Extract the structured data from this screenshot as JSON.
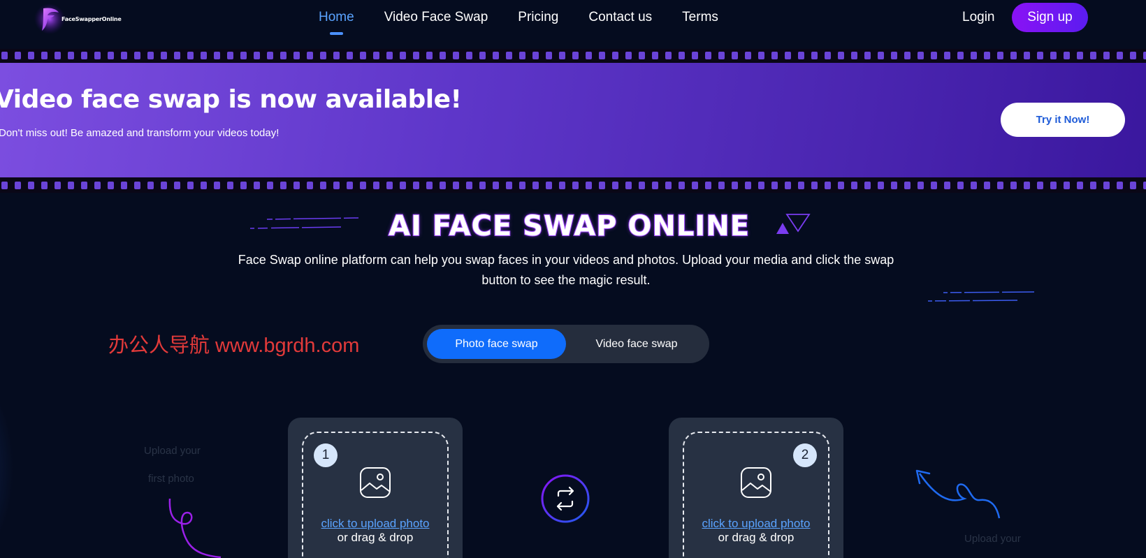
{
  "nav": {
    "logo_text": "FaceSwapperOnline",
    "links": [
      "Home",
      "Video Face Swap",
      "Pricing",
      "Contact us",
      "Terms"
    ],
    "active": "Home",
    "login": "Login",
    "signup": "Sign up"
  },
  "banner": {
    "title": "Video face swap is now available!",
    "subtitle": "Don't miss out! Be amazed and transform your videos today!",
    "cta": "Try it Now!"
  },
  "hero": {
    "title": "AI FACE SWAP ONLINE",
    "description": "Face Swap online platform can help you swap faces in your videos and photos. Upload your media and click the swap button to see the magic result."
  },
  "watermark": "办公人导航  www.bgrdh.com",
  "tabs": {
    "photo": "Photo face swap",
    "video": "Video face swap",
    "selected": "Photo face swap"
  },
  "cards": [
    {
      "number": "1",
      "link": "click to upload photo",
      "drag": "or drag & drop"
    },
    {
      "number": "2",
      "link": "click to upload photo",
      "drag": "or drag & drop"
    }
  ],
  "hints": {
    "left_line1": "Upload your",
    "left_line2": "first photo",
    "right_line1": "Upload your"
  },
  "colors": {
    "background": "#050c1f",
    "accent_blue": "#0f6cfb",
    "accent_purple": "#8a12f5",
    "banner_start": "#7c4ee0",
    "banner_end": "#3a179e",
    "watermark": "#e23a3a"
  },
  "icons": [
    "logo-icon",
    "photo-icon",
    "swap-icon",
    "triangle-decoration",
    "arrow-decoration"
  ]
}
